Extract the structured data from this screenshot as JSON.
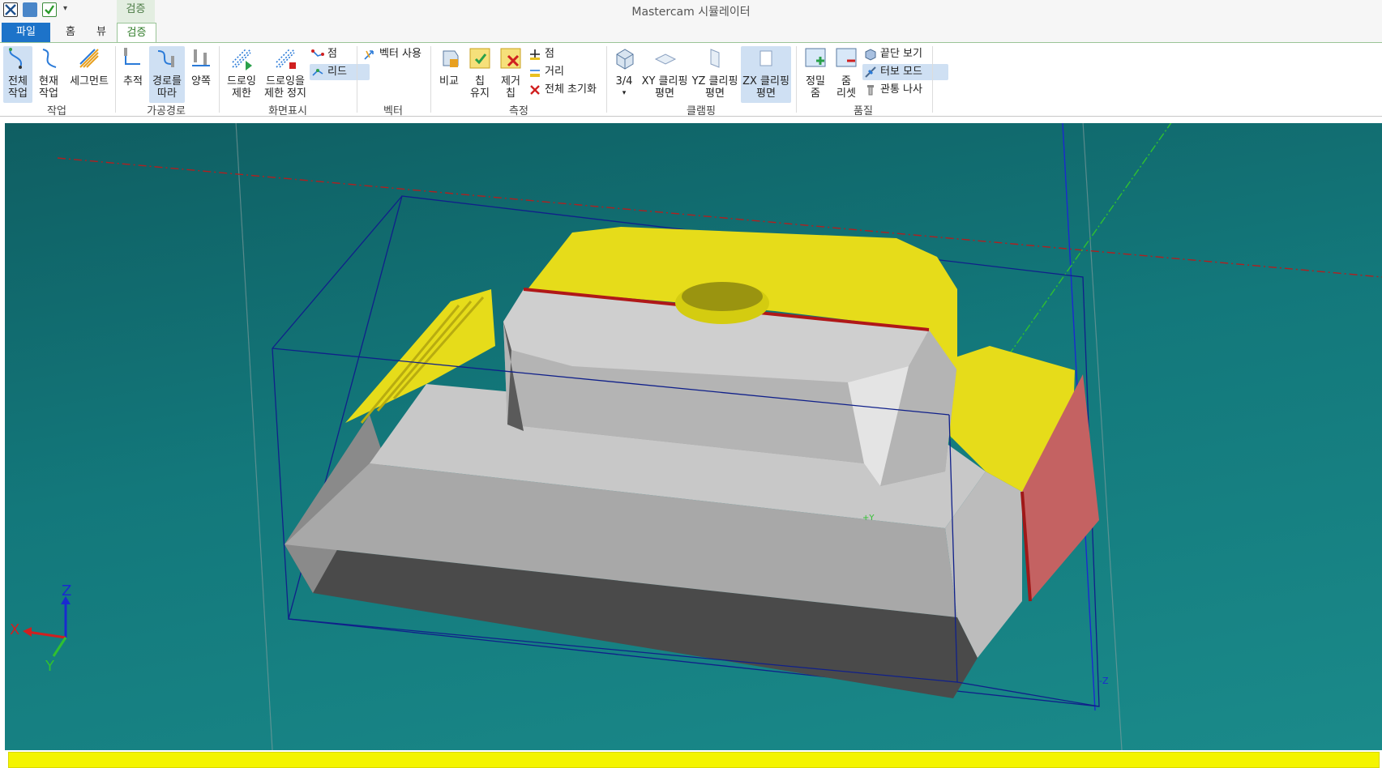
{
  "window": {
    "title": "Mastercam 시뮬레이터",
    "context_tab": "검증"
  },
  "tabs": {
    "file": "파일",
    "home": "홈",
    "view": "뷰",
    "verify": "검증"
  },
  "ribbon": {
    "groups": {
      "work": "작업",
      "toolpath": "가공경로",
      "display": "화면표시",
      "vector": "벡터",
      "measure": "측정",
      "clipping": "클램핑",
      "quality": "품질"
    },
    "work": {
      "all_line1": "전체",
      "all_line2": "작업",
      "current_line1": "현재",
      "current_line2": "작업",
      "segment": "세그먼트"
    },
    "toolpath": {
      "trace": "추적",
      "follow_line1": "경로를",
      "follow_line2": "따라",
      "both": "양쪽"
    },
    "display": {
      "draw_limit_line1": "드로잉",
      "draw_limit_line2": "제한",
      "draw_stop_line1": "드로잉을",
      "draw_stop_line2": "제한 정지",
      "point": "점",
      "lead": "리드"
    },
    "vector": {
      "use_vector": "벡터 사용"
    },
    "measure": {
      "compare": "비교",
      "keep_chip_line1": "칩",
      "keep_chip_line2": "유지",
      "remove_chip_line1": "제거",
      "remove_chip_line2": "칩",
      "point": "점",
      "distance": "거리",
      "reset_all": "전체 초기화"
    },
    "clipping": {
      "three_quarter": "3/4",
      "xy_line1": "XY 클리핑",
      "xy_line2": "평면",
      "yz_line1": "YZ 클리핑",
      "yz_line2": "평면",
      "zx_line1": "ZX 클리핑",
      "zx_line2": "평면"
    },
    "quality": {
      "precise_zoom_line1": "정밀",
      "precise_zoom_line2": "줌",
      "zoom_reset_line1": "줌",
      "zoom_reset_line2": "리셋",
      "end_view": "끝단 보기",
      "turbo_mode": "터보 모드",
      "through_screw": "관통 나사"
    }
  },
  "viewport": {
    "axis_label_y": "+Y",
    "axis_label_z": "-Z",
    "triad": {
      "x": "X",
      "y": "Y",
      "z": "Z"
    }
  },
  "colors": {
    "file_tab": "#1d73c9",
    "selection": "#cfe0f3",
    "viewport_top": "#0f5e62",
    "viewport_bottom": "#1a8a8a",
    "stock_yellow": "#e6dc1a",
    "part_gray": "#a8a8a8",
    "progress": "#f4f400"
  }
}
